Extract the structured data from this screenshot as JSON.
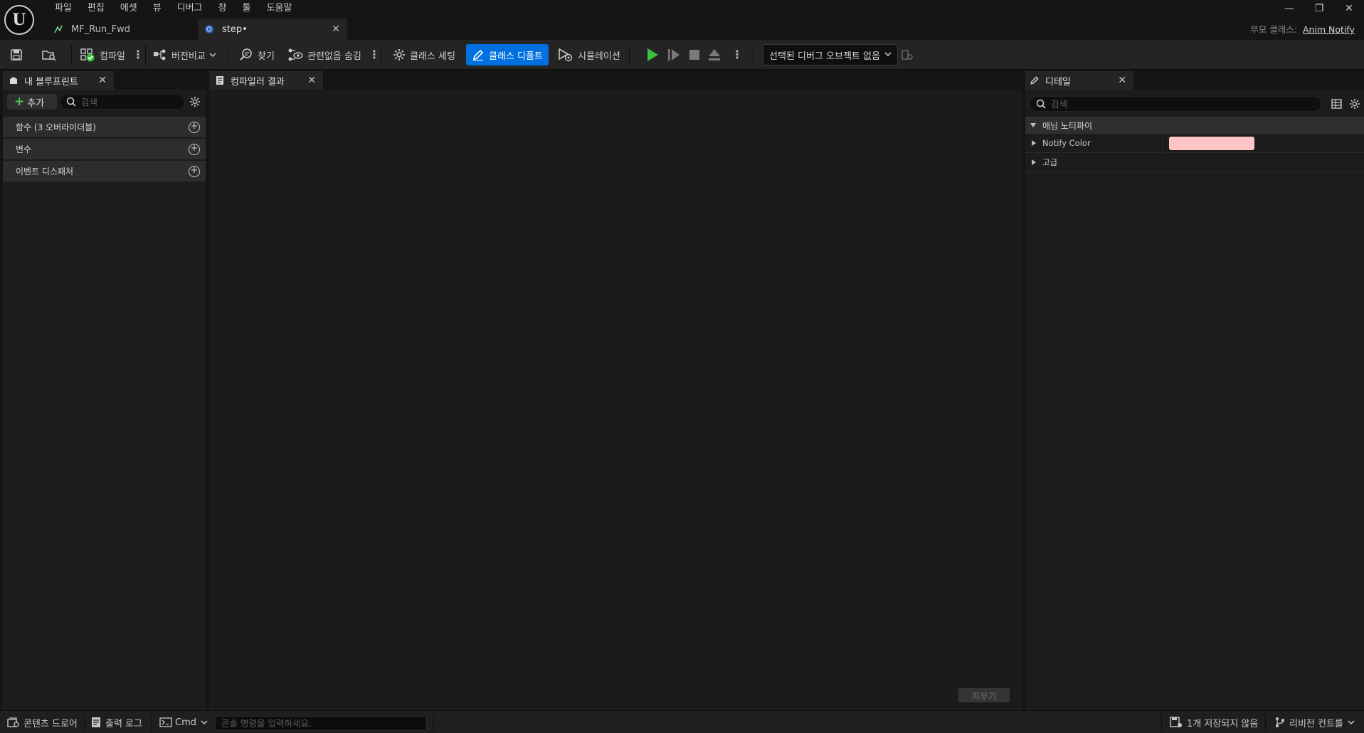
{
  "menu": [
    "파일",
    "편집",
    "에셋",
    "뷰",
    "디버그",
    "창",
    "툴",
    "도움말"
  ],
  "doc_tabs": [
    {
      "label": "MF_Run_Fwd",
      "active": false
    },
    {
      "label": "step•",
      "active": true
    }
  ],
  "parent_class": {
    "label": "부모 클래스:",
    "value": "Anim Notify"
  },
  "window_controls": {
    "minimize": "—",
    "restore": "❐",
    "close": "✕"
  },
  "toolbar": {
    "compile": "컴파일",
    "diff": "버전비교",
    "find": "찾기",
    "hide_unrelated": "관련없음 숨김",
    "class_settings": "클래스 세팅",
    "class_defaults": "클래스 디폴트",
    "simulation": "시뮬레이션",
    "debug_object": "선택된 디버그 오브젝트 없음"
  },
  "my_blueprint": {
    "tab": "내 블루프린트",
    "add": "추가",
    "search_placeholder": "검색",
    "sections": [
      "함수 (3 오버라이더블)",
      "변수",
      "이벤트 디스패처"
    ]
  },
  "compiler_results": {
    "tab": "컴파일러 결과",
    "clear": "지우기"
  },
  "details": {
    "tab": "디테일",
    "search_placeholder": "검색",
    "category": "애님 노티파이",
    "properties": [
      {
        "label": "Notify Color",
        "type": "color",
        "value": "#ffc4c4"
      },
      {
        "label": "고급",
        "type": "group"
      }
    ]
  },
  "statusbar": {
    "content_drawer": "콘텐츠 드로어",
    "output_log": "출력 로그",
    "cmd": "Cmd",
    "console_placeholder": "콘솔 명령을 입력하세요.",
    "unsaved": "1개 저장되지 않음",
    "revision_control": "리비전 컨트롤"
  },
  "colors": {
    "accent": "#0070e0",
    "play_green": "#3fbf3f",
    "add_green": "#4fc04f"
  }
}
